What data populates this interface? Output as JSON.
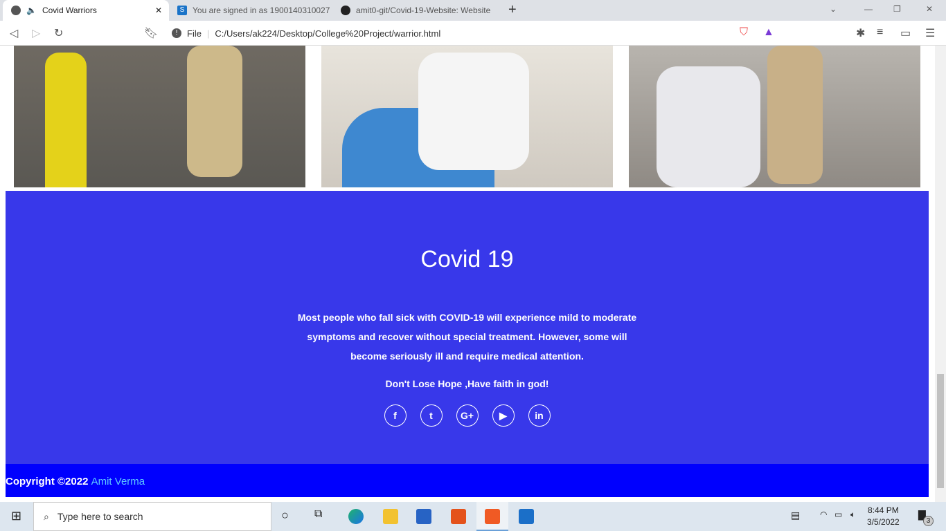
{
  "browser": {
    "tabs": [
      {
        "label": "Covid Warriors",
        "active": true
      },
      {
        "label": "You are signed in as 1900140310027"
      },
      {
        "label": "amit0-git/Covid-19-Website: Website"
      }
    ],
    "new_tab": "+",
    "url_scheme": "File",
    "url": "C:/Users/ak224/Desktop/College%20Project/warrior.html"
  },
  "footer": {
    "title": "Covid 19",
    "description": "Most people who fall sick with COVID-19 will experience mild to moderate symptoms and recover without special treatment. However, some will become seriously ill and require medical attention.",
    "tagline": "Don't Lose Hope ,Have faith in god!",
    "socials": [
      {
        "icon": "facebook-icon",
        "glyph": "f"
      },
      {
        "icon": "twitter-icon",
        "glyph": "t"
      },
      {
        "icon": "google-plus-icon",
        "glyph": "G+"
      },
      {
        "icon": "youtube-icon",
        "glyph": "▶"
      },
      {
        "icon": "linkedin-icon",
        "glyph": "in"
      }
    ],
    "copyright": "Copyright ©2022",
    "author": "Amit Verma",
    "colors": {
      "footer_bg": "#3838ea",
      "copyright_bg": "#0000fe",
      "author_link": "#5ec8ff"
    }
  },
  "taskbar": {
    "search_placeholder": "Type here to search",
    "time": "8:44 PM",
    "date": "3/5/2022",
    "notifications": "3"
  }
}
